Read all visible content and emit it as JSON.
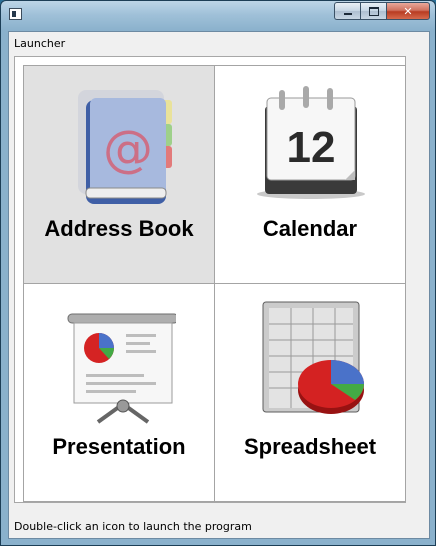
{
  "window": {
    "title": ""
  },
  "heading": "Launcher",
  "launcher": {
    "items": [
      {
        "label": "Address Book",
        "icon": "address-book-icon",
        "selected": true
      },
      {
        "label": "Calendar",
        "icon": "calendar-icon",
        "calendar_day": "12"
      },
      {
        "label": "Presentation",
        "icon": "presentation-icon"
      },
      {
        "label": "Spreadsheet",
        "icon": "spreadsheet-icon"
      }
    ]
  },
  "status": "Double-click an icon to launch the program",
  "colors": {
    "selected_bg": "#e1e1e1",
    "title_bar": "#9fc0d8",
    "close_button": "#c7452a"
  }
}
